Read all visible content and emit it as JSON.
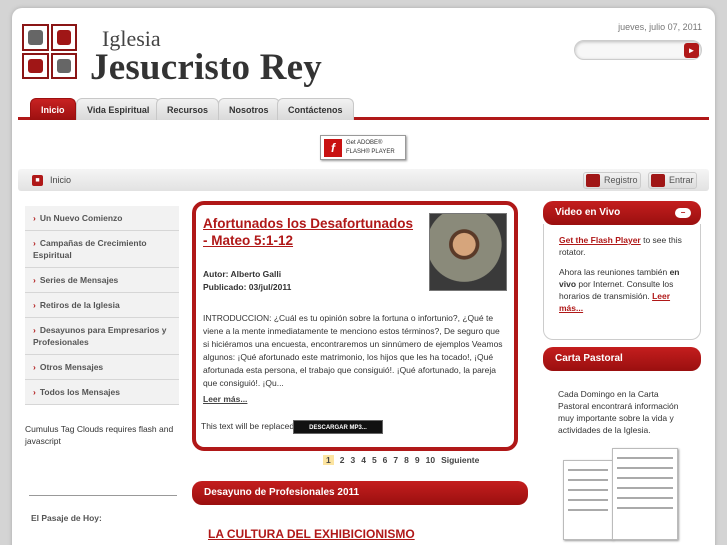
{
  "header": {
    "brand_small": "Iglesia",
    "brand_big": "Jesucristo Rey",
    "date": "jueves, julio 07, 2011",
    "search_placeholder": "",
    "search_button_icon": "arrow-right-icon"
  },
  "nav": {
    "tabs": [
      {
        "label": "Inicio",
        "active": true
      },
      {
        "label": "Vida Espiritual",
        "active": false
      },
      {
        "label": "Recursos",
        "active": false
      },
      {
        "label": "Nosotros",
        "active": false
      },
      {
        "label": "Contáctenos",
        "active": false
      }
    ]
  },
  "flash_badge": {
    "line1": "Get ADOBE®",
    "line2": "FLASH® PLAYER"
  },
  "breadcrumb": {
    "label": "Inicio"
  },
  "top_buttons": {
    "registro": "Registro",
    "entrar": "Entrar"
  },
  "left_nav": {
    "items": [
      "Un Nuevo Comienzo",
      "Campañas de Crecimiento Espiritual",
      "Series de Mensajes",
      "Retiros de la Iglesia",
      "Desayunos para Empresarios y Profesionales",
      "Otros Mensajes",
      "Todos los Mensajes"
    ],
    "cumulus": "Cumulus Tag Clouds requires flash and javascript",
    "pasaje": "El Pasaje de Hoy:"
  },
  "article": {
    "title": "Afortunados los Desafortunados - Mateo 5:1-12",
    "author": "Autor: Alberto Galli",
    "published": "Publicado: 03/jul/2011",
    "body": "INTRODUCCION: ¿Cuál es tu opinión sobre la fortuna o infortunio?, ¿Qué te viene a la mente inmediatamente te menciono estos términos?, De seguro que si hiciéramos una encuesta, encontraremos un sinnúmero de ejemplos Veamos algunos: ¡Qué afortunado este matrimonio, los hijos que les ha tocado!, ¡Qué afortunada esta persona, el trabajo que consiguió!. ¡Qué afortunado, la pareja que consiguió!. ¡Qu...",
    "more": "Leer más...",
    "replace_text": "This text will be replaced",
    "mp3_button": "DESCARGAR MP3..."
  },
  "pager": {
    "pages": [
      "1",
      "2",
      "3",
      "4",
      "5",
      "6",
      "7",
      "8",
      "9",
      "10"
    ],
    "current": "1",
    "next": "Siguiente"
  },
  "desayuno": {
    "title": "Desayuno de Profesionales 2011",
    "headline": "LA CULTURA DEL EXHIBICIONISMO"
  },
  "video": {
    "title": "Video en Vivo",
    "toggle": "−",
    "flash_link": "Get the Flash Player",
    "flash_rest": " to see this rotator.",
    "p2_a": "Ahora las reuniones también ",
    "p2_bold": "en vivo",
    "p2_b": " por Internet. Consulte los horarios de transmisión. ",
    "p2_link": "Leer más..."
  },
  "pastoral": {
    "title": "Carta Pastoral",
    "text": "Cada Domingo en la Carta Pastoral encontrará información muy importante sobre la vida y actividades de la Iglesia."
  },
  "colors": {
    "accent": "#b01818"
  }
}
